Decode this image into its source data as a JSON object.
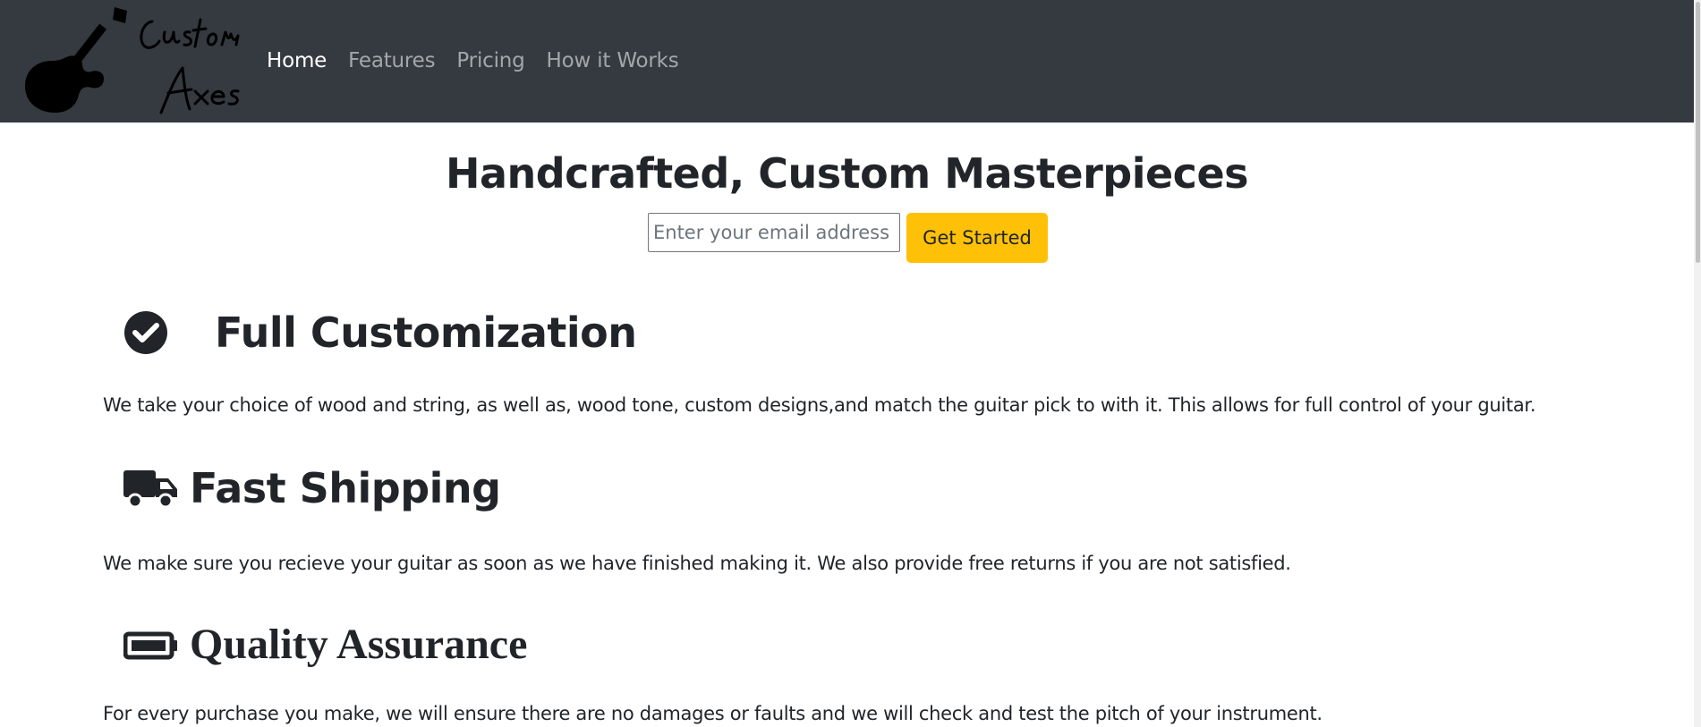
{
  "brand": {
    "logo_text_line1": "Custom",
    "logo_text_line2": "Axes",
    "icon": "guitar-icon"
  },
  "nav": {
    "items": [
      {
        "label": "Home",
        "active": true
      },
      {
        "label": "Features",
        "active": false
      },
      {
        "label": "Pricing",
        "active": false
      },
      {
        "label": "How it Works",
        "active": false
      }
    ]
  },
  "hero": {
    "title": "Handcrafted, Custom Masterpieces",
    "email_placeholder": "Enter your email address",
    "email_value": "",
    "cta_label": "Get Started"
  },
  "features": [
    {
      "icon": "check-circle-icon",
      "title": "Full Customization",
      "text": "We take your choice of wood and string, as well as, wood tone, custom designs,and match the guitar pick to with it. This allows for full control of your guitar."
    },
    {
      "icon": "truck-icon",
      "title": "Fast Shipping",
      "text": "We make sure you recieve your guitar as soon as we have finished making it. We also provide free returns if you are not satisfied."
    },
    {
      "icon": "battery-icon",
      "title": "Quality Assurance",
      "text": "For every purchase you make, we will ensure there are no damages or faults and we will check and test the pitch of your instrument."
    }
  ],
  "colors": {
    "navbar_bg": "#343a40",
    "cta_bg": "#ffc107",
    "text": "#212529"
  }
}
